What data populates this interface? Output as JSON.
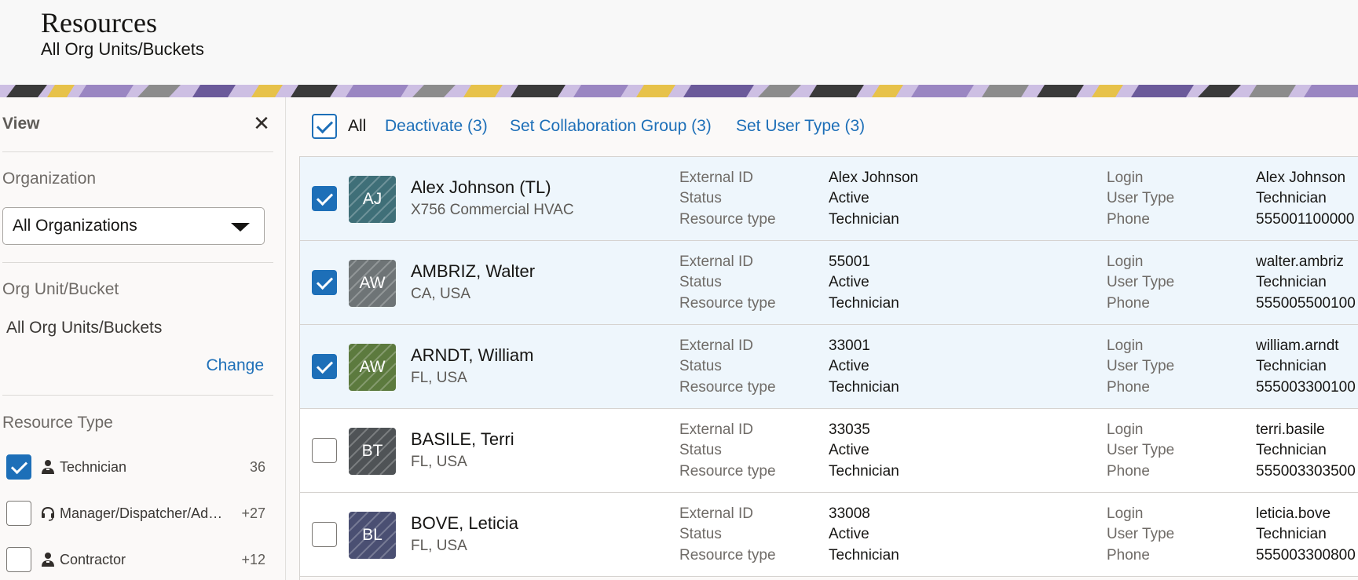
{
  "header": {
    "title": "Resources",
    "subtitle": "All Org Units/Buckets"
  },
  "sidebar": {
    "title": "View",
    "close_icon": "close-icon",
    "organization": {
      "label": "Organization",
      "selected": "All Organizations"
    },
    "org_unit": {
      "label": "Org Unit/Bucket",
      "value": "All Org Units/Buckets",
      "change_label": "Change"
    },
    "resource_type": {
      "label": "Resource Type",
      "items": [
        {
          "label": "Technician",
          "count": "36",
          "checked": true,
          "icon": "person-icon"
        },
        {
          "label": "Manager/Dispatcher/Ad…",
          "count": "+27",
          "checked": false,
          "icon": "headset-icon"
        },
        {
          "label": "Contractor",
          "count": "+12",
          "checked": false,
          "icon": "person-icon"
        }
      ]
    }
  },
  "toolbar": {
    "all_label": "All",
    "deactivate": "Deactivate (3)",
    "set_collab": "Set Collaboration Group (3)",
    "set_user_type": "Set User Type (3)"
  },
  "field_labels": {
    "external_id": "External ID",
    "status": "Status",
    "resource_type": "Resource type",
    "login": "Login",
    "user_type": "User Type",
    "phone": "Phone"
  },
  "resources": [
    {
      "initials": "AJ",
      "name": "Alex Johnson (TL)",
      "location": "X756 Commercial HVAC",
      "external_id": "Alex Johnson",
      "status": "Active",
      "resource_type": "Technician",
      "login": "Alex Johnson",
      "user_type": "Technician",
      "phone": "555001100000",
      "selected": true,
      "avatar_color": "#3f6f78"
    },
    {
      "initials": "AW",
      "name": "AMBRIZ, Walter",
      "location": "CA, USA",
      "external_id": "55001",
      "status": "Active",
      "resource_type": "Technician",
      "login": "walter.ambriz",
      "user_type": "Technician",
      "phone": "555005500100",
      "selected": true,
      "avatar_color": "#6e7476"
    },
    {
      "initials": "AW",
      "name": "ARNDT, William",
      "location": "FL, USA",
      "external_id": "33001",
      "status": "Active",
      "resource_type": "Technician",
      "login": "william.arndt",
      "user_type": "Technician",
      "phone": "555003300100",
      "selected": true,
      "avatar_color": "#5c7a3e"
    },
    {
      "initials": "BT",
      "name": "BASILE, Terri",
      "location": "FL, USA",
      "external_id": "33035",
      "status": "Active",
      "resource_type": "Technician",
      "login": "terri.basile",
      "user_type": "Technician",
      "phone": "555003303500",
      "selected": false,
      "avatar_color": "#4f5356"
    },
    {
      "initials": "BL",
      "name": "BOVE, Leticia",
      "location": "FL, USA",
      "external_id": "33008",
      "status": "Active",
      "resource_type": "Technician",
      "login": "leticia.bove",
      "user_type": "Technician",
      "phone": "555003300800",
      "selected": false,
      "avatar_color": "#4a4f72"
    }
  ]
}
